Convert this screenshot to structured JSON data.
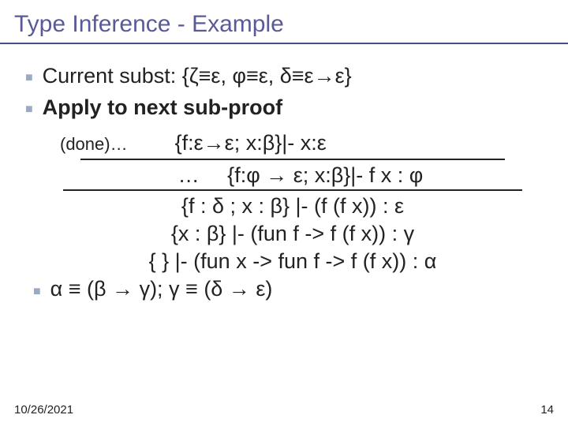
{
  "title": "Type Inference - Example",
  "bullets": {
    "b1": "Current subst: {ζ≡ε, φ≡ε, δ≡ε→ε}",
    "b2": "Apply to next sub-proof"
  },
  "proof": {
    "done": "(done)…",
    "r1_right": "{f:ε→ε; x:β}|- x:ε",
    "r2_dots": "…",
    "r2": "{f:φ → ε; x:β}|- f x : φ",
    "r3": "{f : δ ; x : β} |- (f (f x)) : ε",
    "r4": "{x : β} |- (fun f -> f (f x)) : γ",
    "r5": "{ } |- (fun x -> fun f -> f (f x)) : α"
  },
  "final_bullet": "α ≡ (β → γ); γ ≡ (δ → ε)",
  "footer": {
    "date": "10/26/2021",
    "page": "14"
  }
}
